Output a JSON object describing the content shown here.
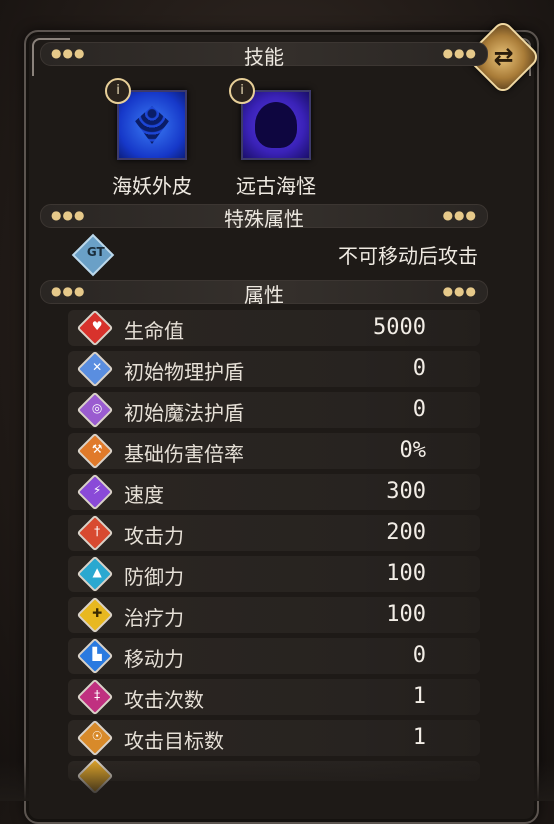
{
  "sections": {
    "skills_title": "技能",
    "special_title": "特殊属性",
    "attributes_title": "属性"
  },
  "skills": [
    {
      "name": "海妖外皮",
      "icon": "scale-armor-icon",
      "color": "#2a56e0"
    },
    {
      "name": "远古海怪",
      "icon": "sea-monster-icon",
      "color": "#4a2fd0"
    }
  ],
  "special": {
    "icon": "gt-badge-icon",
    "text": "不可移动后攻击"
  },
  "attributes": [
    {
      "label": "生命值",
      "value": "5000",
      "icon": "heart-icon",
      "color": "#d8322c"
    },
    {
      "label": "初始物理护盾",
      "value": "0",
      "icon": "physical-shield-icon",
      "color": "#5a8ee0"
    },
    {
      "label": "初始魔法护盾",
      "value": "0",
      "icon": "magic-shield-icon",
      "color": "#9a5cd0"
    },
    {
      "label": "基础伤害倍率",
      "value": "0%",
      "icon": "axe-icon",
      "color": "#e07a2a"
    },
    {
      "label": "速度",
      "value": "300",
      "icon": "lightning-icon",
      "color": "#8a4ad8"
    },
    {
      "label": "攻击力",
      "value": "200",
      "icon": "sword-icon",
      "color": "#d84a30"
    },
    {
      "label": "防御力",
      "value": "100",
      "icon": "armor-icon",
      "color": "#2aa8d0"
    },
    {
      "label": "治疗力",
      "value": "100",
      "icon": "cross-icon",
      "color": "#e8b820"
    },
    {
      "label": "移动力",
      "value": "0",
      "icon": "boot-icon",
      "color": "#2a7ae0"
    },
    {
      "label": "攻击次数",
      "value": "1",
      "icon": "double-sword-icon",
      "color": "#c03080"
    },
    {
      "label": "攻击目标数",
      "value": "1",
      "icon": "target-icon",
      "color": "#d88a2a"
    }
  ]
}
